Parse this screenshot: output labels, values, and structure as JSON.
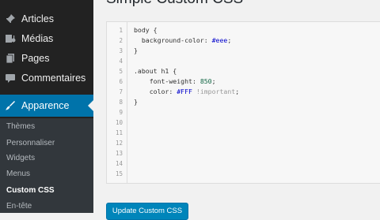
{
  "page": {
    "title": "Simple Custom CSS"
  },
  "sidebar": {
    "items": [
      {
        "label": "Articles",
        "icon": "pin-icon"
      },
      {
        "label": "Médias",
        "icon": "media-icon"
      },
      {
        "label": "Pages",
        "icon": "pages-icon"
      },
      {
        "label": "Commentaires",
        "icon": "comments-icon"
      },
      {
        "label": "Apparence",
        "icon": "appearance-brush-icon",
        "active": true
      }
    ],
    "submenu": [
      "Thèmes",
      "Personnaliser",
      "Widgets",
      "Menus",
      "Custom CSS",
      "En-tête"
    ],
    "current_submenu": "Custom CSS"
  },
  "editor": {
    "line_numbers": [
      "1",
      "2",
      "3",
      "4",
      "5",
      "6",
      "7",
      "8",
      "9",
      "10",
      "11",
      "12",
      "13",
      "14",
      "15"
    ],
    "lines": [
      "body {",
      "  background-color: #eee;",
      "}",
      "",
      ".about h1 {",
      "    font-weight: 850;",
      "    color: #FFF !important;",
      "}"
    ]
  },
  "actions": {
    "update_label": "Update Custom CSS"
  },
  "colors": {
    "accent": "#0073aa",
    "sidebar_bg": "#222222",
    "submenu_bg": "#32373c"
  }
}
